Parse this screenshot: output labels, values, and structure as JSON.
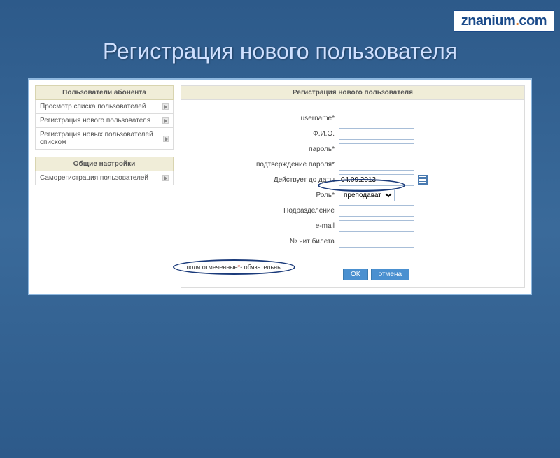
{
  "brand": {
    "part1": "znanium",
    "part2": "com"
  },
  "page_title": "Регистрация нового пользователя",
  "sidebar": {
    "section1_title": "Пользователи абонента",
    "section1_items": [
      "Просмотр списка пользователей",
      "Регистрация нового пользователя",
      "Регистрация новых пользователей списком"
    ],
    "section2_title": "Общие настройки",
    "section2_items": [
      "Саморегистрация пользователей"
    ]
  },
  "form": {
    "title": "Регистрация нового пользователя",
    "labels": {
      "username": "username*",
      "fio": "Ф.И.О.",
      "password": "пароль*",
      "confirm": "подтверждение пароля*",
      "valid": "Действует до даты",
      "role": "Роль*",
      "dept": "Подразделение",
      "email": "e-mail",
      "ticket": "№ чит билета"
    },
    "values": {
      "username": "",
      "fio": "",
      "password": "",
      "confirm": "",
      "valid": "04.09.2013",
      "role": "преподаватель",
      "dept": "",
      "email": "",
      "ticket": ""
    },
    "buttons": {
      "ok": "ОК",
      "cancel": "отмена"
    }
  },
  "note": {
    "pre": "поля отмеченные ",
    "ast": "*",
    "post": " - обязательны"
  }
}
